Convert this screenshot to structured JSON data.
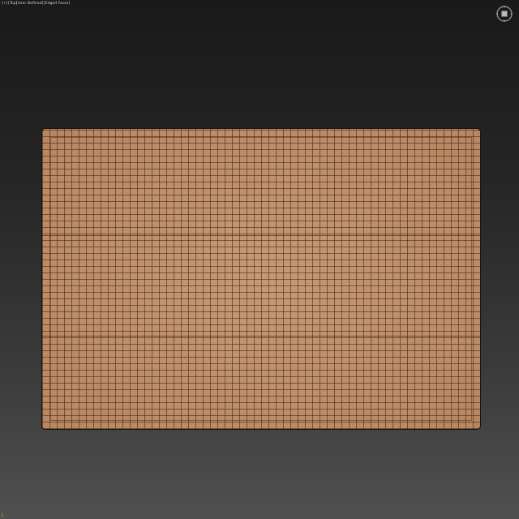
{
  "viewport": {
    "labels": [
      "[+]",
      "[Top]",
      "[User Defined]",
      "[Edged Faces]"
    ],
    "background_top": "#191919",
    "background_bottom": "#505050"
  },
  "scene": {
    "object": "rug-plane",
    "display": "edged-faces",
    "base_color": "#c08c68",
    "edge_color": "#372012"
  },
  "icons": {
    "viewcube": "viewcube-compass-icon",
    "axis": "axis-tripod-icon"
  }
}
